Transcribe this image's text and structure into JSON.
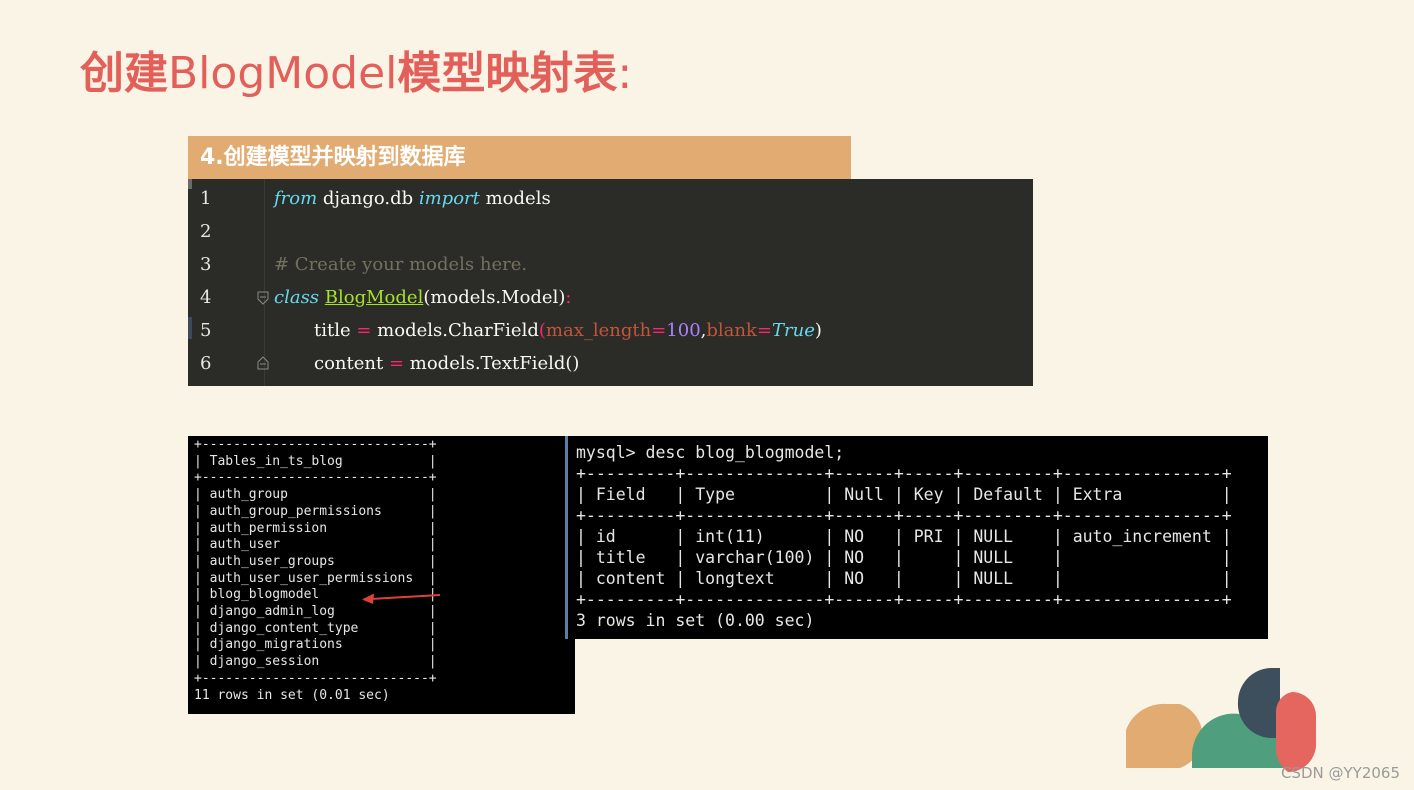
{
  "title": {
    "cn_prefix": "创建",
    "en_mid": "BlogModel",
    "cn_suffix": "模型映射表",
    "colon": ":"
  },
  "section_header": "4.创建模型并映射到数据库",
  "code": {
    "lines": [
      {
        "no": "1"
      },
      {
        "no": "2"
      },
      {
        "no": "3",
        "comment": "# Create your models here."
      },
      {
        "no": "4"
      },
      {
        "no": "5"
      },
      {
        "no": "6"
      }
    ],
    "tokens": {
      "from": "from",
      "module": " django.db ",
      "import": "import",
      "models": " models",
      "class": "class",
      "space": " ",
      "class_name": "BlogModel",
      "base": "(models.Model)",
      "colon": ":",
      "title_var": "title",
      "eq1": " = ",
      "charfield": "models.CharField",
      "paren_open": "(",
      "max_length": "max_length",
      "eq2": "=",
      "hundred": "100",
      "comma": ",",
      "blank": "blank",
      "eq3": "=",
      "true_val": "True",
      "paren_close": ")",
      "content_var": "content",
      "eq4": " = ",
      "textfield": "models.TextField()"
    }
  },
  "terminal_tables": "+-----------------------------+\n| Tables_in_ts_blog           |\n+-----------------------------+\n| auth_group                  |\n| auth_group_permissions      |\n| auth_permission             |\n| auth_user                   |\n| auth_user_groups            |\n| auth_user_user_permissions  |\n| blog_blogmodel              |\n| django_admin_log            |\n| django_content_type         |\n| django_migrations           |\n| django_session              |\n+-----------------------------+\n11 rows in set (0.01 sec)",
  "terminal_desc": "mysql> desc blog_blogmodel;\n+---------+--------------+------+-----+---------+----------------+\n| Field   | Type         | Null | Key | Default | Extra          |\n+---------+--------------+------+-----+---------+----------------+\n| id      | int(11)      | NO   | PRI | NULL    | auto_increment |\n| title   | varchar(100) | NO   |     | NULL    |                |\n| content | longtext     | NO   |     | NULL    |                |\n+---------+--------------+------+-----+---------+----------------+\n3 rows in set (0.00 sec)",
  "watermark": "CSDN @YY2065",
  "colors": {
    "title": "#e3605a",
    "header_bg": "#e2ab72",
    "arrow": "#e0403a",
    "deco_orange": "#e2ab72",
    "deco_green": "#4f9e7e",
    "deco_navy": "#3d4f5c",
    "deco_red": "#e5665e"
  }
}
